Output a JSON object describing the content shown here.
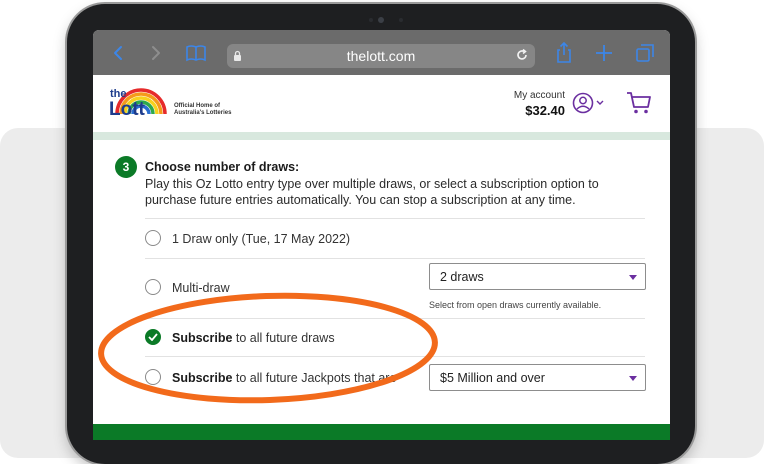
{
  "browser": {
    "url": "thelott.com"
  },
  "header": {
    "logo_top": "the",
    "logo_main": "Lott",
    "tagline_line1": "Official Home of",
    "tagline_line2": "Australia's Lotteries",
    "account_label": "My account",
    "account_balance": "$32.40"
  },
  "step": {
    "number": "3",
    "title": "Choose number of draws:",
    "description": "Play this Oz Lotto entry type over multiple draws, or select a subscription option to purchase future entries automatically. You can stop a subscription at any time."
  },
  "options": {
    "single": {
      "label": "1 Draw only (Tue, 17 May 2022)",
      "checked": false
    },
    "multi": {
      "label": "Multi-draw",
      "checked": false,
      "select_value": "2 draws",
      "help": "Select from open draws currently available."
    },
    "subscribe_all": {
      "label_bold": "Subscribe",
      "label_rest": " to all future draws",
      "checked": true
    },
    "subscribe_jackpots": {
      "label_bold": "Subscribe",
      "label_rest": " to all future Jackpots that are",
      "checked": false,
      "select_value": "$5 Million and over"
    }
  },
  "colors": {
    "brand_green": "#0b7a27",
    "accent_purple": "#6b2fa0",
    "annotation_orange": "#f26a1b"
  }
}
